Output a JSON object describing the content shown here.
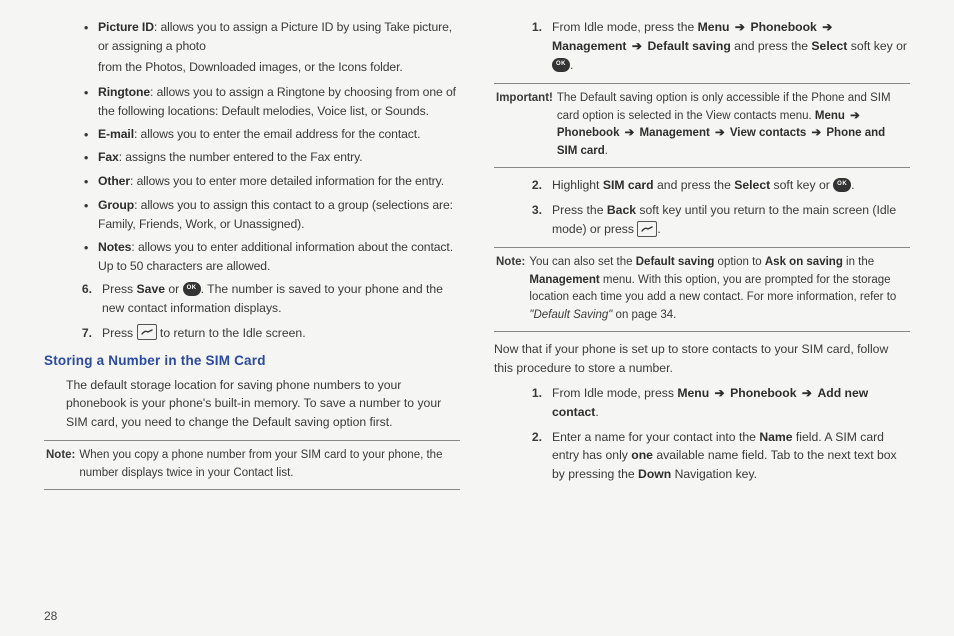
{
  "left": {
    "bulletIndent": [
      {
        "lead": "Picture ID",
        "tail": ": allows you to assign a Picture ID by using Take picture, or assigning a photo",
        "sub": "from the Photos, Downloaded images, or the Icons folder."
      },
      {
        "lead": "Ringtone",
        "tail": ": allows you to assign a Ringtone by choosing from one of the following locations: Default melodies, Voice list, or Sounds."
      },
      {
        "lead": "E-mail",
        "tail": ": allows you to enter the email address for the contact."
      },
      {
        "lead": "Fax",
        "tail": ": assigns the number entered to the Fax entry."
      },
      {
        "lead": "Other",
        "tail": ": allows you to enter more detailed information for the entry."
      },
      {
        "lead": "Group",
        "tail": ": allows you to assign this contact to a group (selections are: Family, Friends, Work, or Unassigned)."
      },
      {
        "lead": "Notes",
        "tail": ": allows you to enter additional information about the contact. Up to 50 characters are allowed."
      }
    ],
    "step6": {
      "idx": "6.",
      "pre": "Press ",
      "save": "Save",
      "mid": " or ",
      "post": ". The number is saved to your phone and the new contact information displays."
    },
    "step7": {
      "idx": "7.",
      "pre": "Press ",
      "post": " to return to the Idle screen."
    },
    "section": "Storing a Number in the SIM Card",
    "para": "The default storage location for saving phone numbers to your phonebook is your phone's built-in memory. To save a number to your SIM card, you need to change the Default saving option first.",
    "note": {
      "label": "Note:",
      "text": "When you copy a phone number from your SIM card to your phone, the number displays twice in your Contact list."
    }
  },
  "right": {
    "step1": {
      "idx": "1.",
      "parts": [
        "From Idle mode, press the ",
        {
          "b": "Menu"
        },
        {
          "arr": "➔"
        },
        {
          "b": "Phonebook"
        },
        {
          "arr": "➔"
        },
        {
          "b": "Management"
        },
        {
          "arr": "➔"
        },
        {
          "b": "Default saving"
        },
        " and press the ",
        {
          "b": "Select"
        },
        " soft key or ",
        {
          "ok": true
        },
        "."
      ]
    },
    "important": {
      "label": "Important!",
      "line1": "The Default saving option is only accessible if the Phone and SIM card option is selected in the View contacts menu.",
      "bold_parts": [
        "Menu",
        "➔",
        "Phonebook",
        "➔",
        "Management",
        "➔",
        "View contacts",
        "➔",
        "Phone and SIM card"
      ],
      "suffix": "."
    },
    "step2": {
      "idx": "2.",
      "parts": [
        "Highlight ",
        {
          "b": "SIM card"
        },
        " and press the ",
        {
          "b": "Select"
        },
        " soft key or ",
        {
          "ok": true
        },
        "."
      ]
    },
    "step3": {
      "idx": "3.",
      "parts": [
        "Press the ",
        {
          "b": "Back"
        },
        " soft key until you return to the main screen (Idle mode) or press ",
        {
          "end": true
        },
        "."
      ]
    },
    "note2": {
      "label": "Note:",
      "parts": [
        "You can also set the ",
        {
          "b": "Default saving"
        },
        " option to ",
        {
          "b": "Ask on saving"
        },
        " in the ",
        {
          "b": "Management"
        },
        " menu. With this option, you are prompted for the storage location each time you add a new contact. For more information, refer to ",
        {
          "i": "\"Default Saving\""
        },
        "  on page 34."
      ]
    },
    "para2": "Now that if your phone is set up to store contacts to your SIM card, follow this procedure to store a number.",
    "b_step1": {
      "idx": "1.",
      "parts": [
        "From Idle mode, press ",
        {
          "b": "Menu"
        },
        {
          "arr": "➔"
        },
        {
          "b": "Phonebook"
        },
        {
          "arr": "➔"
        },
        {
          "b": "Add new contact"
        },
        "."
      ]
    },
    "b_step2": {
      "idx": "2.",
      "parts": [
        "Enter a name for your contact into the ",
        {
          "b": "Name"
        },
        " field. A SIM card entry has only ",
        {
          "b": "one"
        },
        " available name field. Tab to the next text box by pressing the ",
        {
          "b": "Down"
        },
        " Navigation key."
      ]
    }
  },
  "icons": {
    "ok_text": "OK"
  },
  "pagenum": "28"
}
